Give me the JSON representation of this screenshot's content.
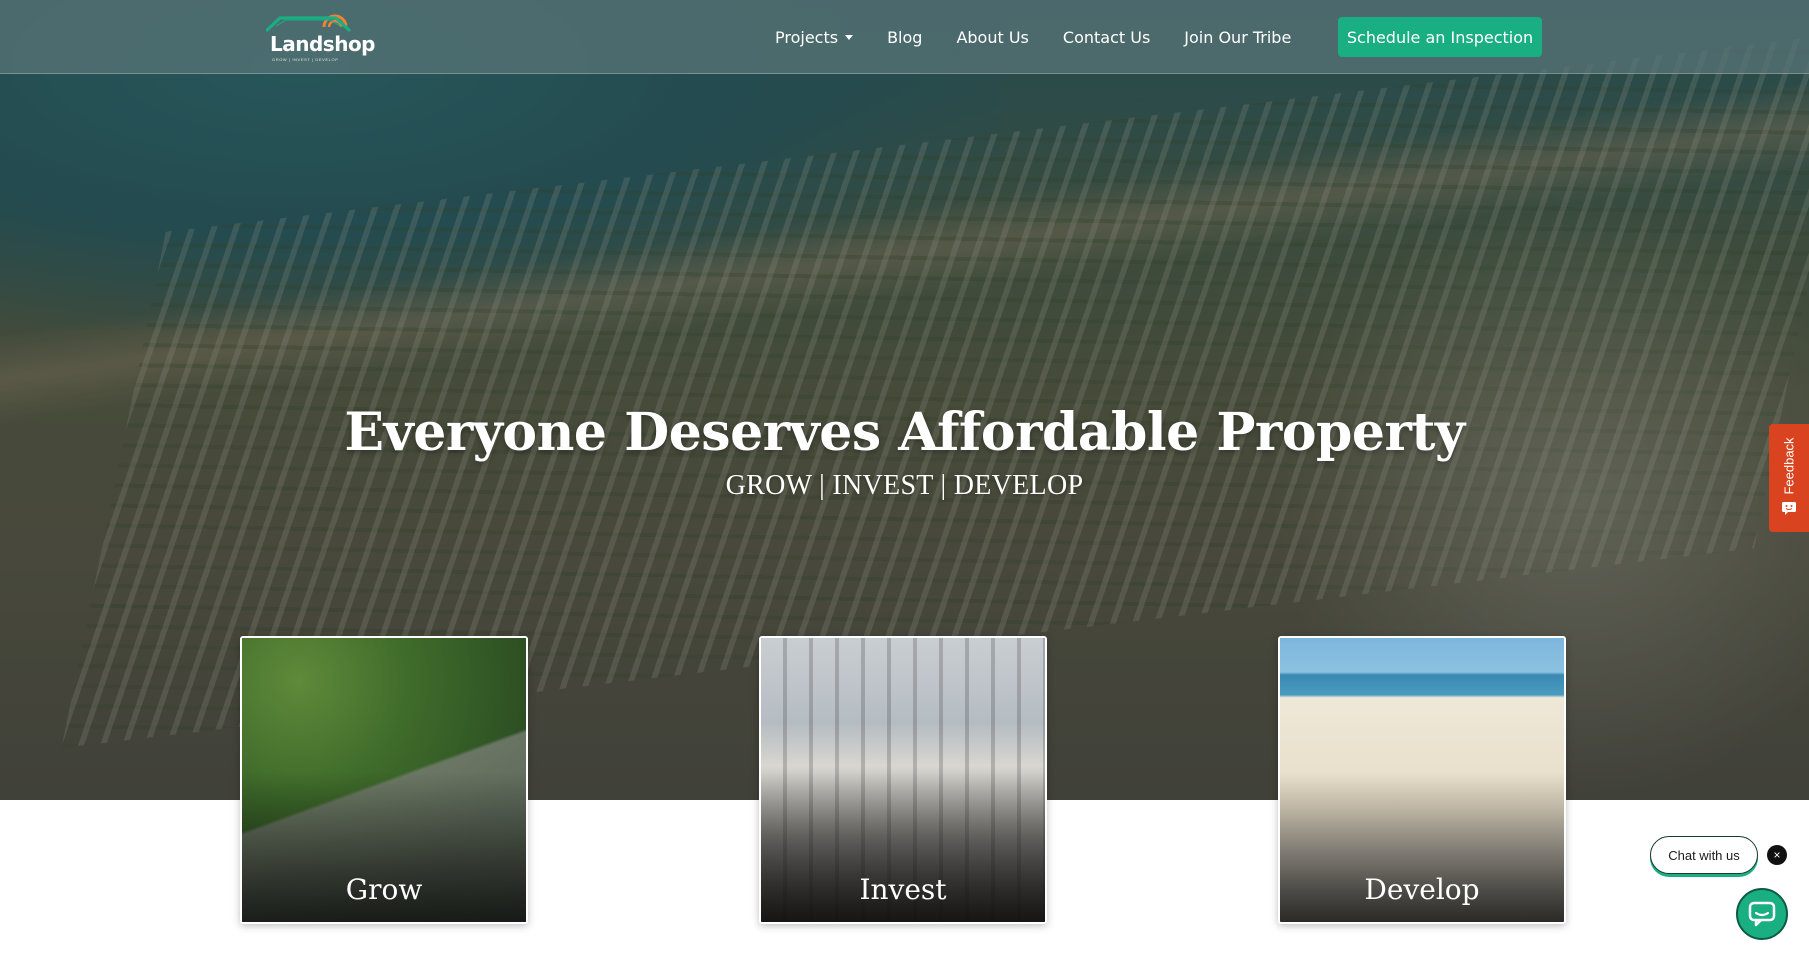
{
  "brand": {
    "name": "Landshop",
    "tagline": "GROW | INVEST | DEVELOP",
    "logo_colors": {
      "roof": "#1aae83",
      "sun": "#f2813a"
    }
  },
  "nav": {
    "items": [
      {
        "label": "Projects",
        "has_dropdown": true
      },
      {
        "label": "Blog"
      },
      {
        "label": "About Us"
      },
      {
        "label": "Contact Us"
      },
      {
        "label": "Join Our Tribe"
      }
    ],
    "cta_label": "Schedule an Inspection"
  },
  "hero": {
    "title": "Everyone Deserves Affordable Property",
    "subtitle": "GROW | INVEST | DEVELOP"
  },
  "cards": [
    {
      "title": "Grow"
    },
    {
      "title": "Invest"
    },
    {
      "title": "Develop"
    }
  ],
  "feedback": {
    "label": "Feedback",
    "color": "#d9431f"
  },
  "chat": {
    "bubble_label": "Chat with us",
    "close_symbol": "×",
    "accent_color": "#1aae83"
  },
  "icons": {
    "nav_dropdown": "chevron-down-icon",
    "feedback": "feedback-icon",
    "chat_close": "close-icon",
    "chat_launcher": "chat-icon"
  },
  "colors": {
    "accent": "#1aae83",
    "nav_background": "#5a7678"
  }
}
